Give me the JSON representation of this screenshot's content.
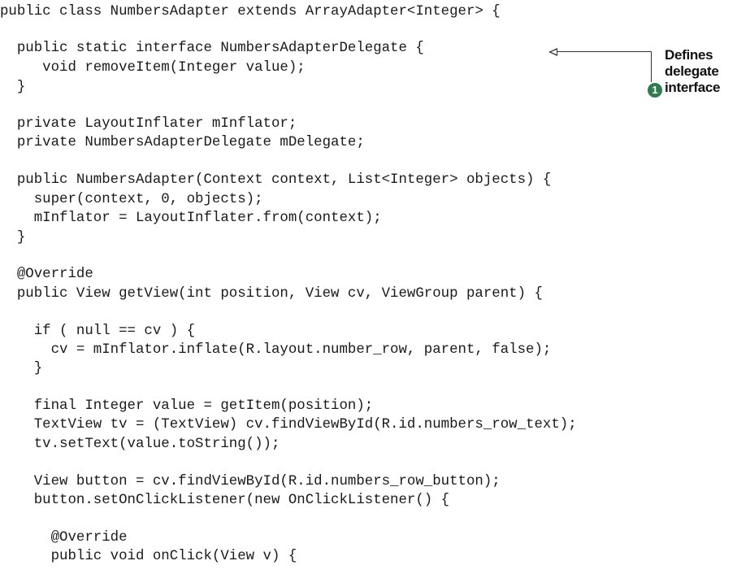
{
  "code_lines": [
    "public class NumbersAdapter extends ArrayAdapter<Integer> {",
    "  public static interface NumbersAdapterDelegate {",
    "     void removeItem(Integer value);",
    "  }",
    "  private LayoutInflater mInflator;",
    "  private NumbersAdapterDelegate mDelegate;",
    "  public NumbersAdapter(Context context, List<Integer> objects) {",
    "    super(context, 0, objects);",
    "    mInflator = LayoutInflater.from(context);",
    "  }",
    "  @Override",
    "  public View getView(int position, View cv, ViewGroup parent) {",
    "    if ( null == cv ) {",
    "      cv = mInflator.inflate(R.layout.number_row, parent, false);",
    "    }",
    "    final Integer value = getItem(position);",
    "    TextView tv = (TextView) cv.findViewById(R.id.numbers_row_text);",
    "    tv.setText(value.toString());",
    "    View button = cv.findViewById(R.id.numbers_row_button);",
    "    button.setOnClickListener(new OnClickListener() {",
    "      @Override",
    "      public void onClick(View v) {"
  ],
  "callout": {
    "number": "1",
    "lines": [
      "Defines",
      "delegate",
      "interface"
    ]
  },
  "colors": {
    "badge": "#2f7d4f",
    "text": "#1a1a1a"
  }
}
